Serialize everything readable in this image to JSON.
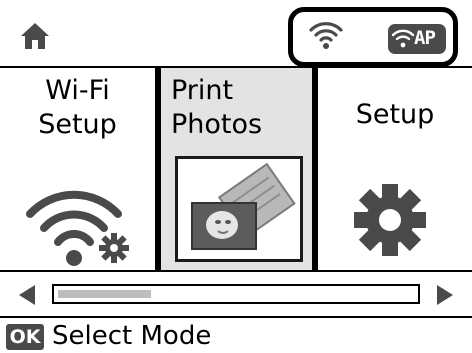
{
  "status": {
    "access_point_label": "AP"
  },
  "menu": {
    "items": [
      {
        "line1": "Wi-Fi",
        "line2": "Setup",
        "icon": "wifi-gear-icon",
        "selected": false
      },
      {
        "line1": "Print",
        "line2": "Photos",
        "icon": "photo-icon",
        "selected": true
      },
      {
        "line1": "Setup",
        "line2": "",
        "icon": "gear-icon",
        "selected": false
      }
    ]
  },
  "scroll": {
    "position_fraction": 0.0,
    "visible_fraction": 0.26
  },
  "footer": {
    "button_label": "OK",
    "hint": "Select Mode"
  },
  "colors": {
    "selected_panel": "#e3e3e3",
    "badge": "#4a4a4a",
    "border": "#000000"
  }
}
